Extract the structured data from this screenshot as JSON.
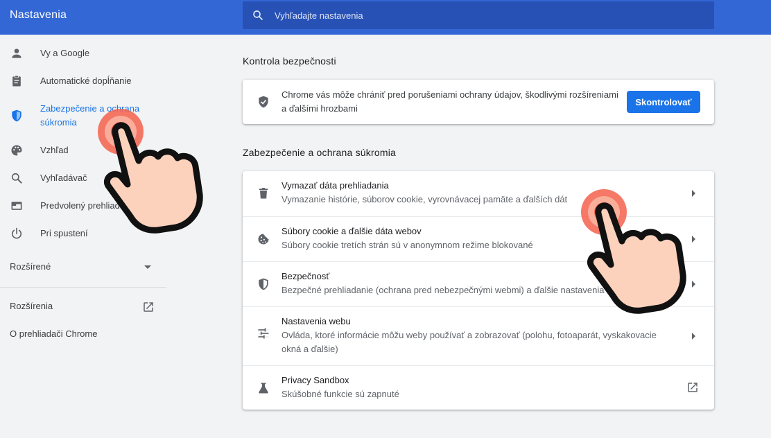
{
  "header": {
    "title": "Nastavenia",
    "search_placeholder": "Vyhľadajte nastavenia"
  },
  "sidebar": {
    "items": [
      {
        "label": "Vy a Google",
        "icon": "person-icon"
      },
      {
        "label": "Automatické dopĺňanie",
        "icon": "clipboard-icon"
      },
      {
        "label_line1": "Zabezpečenie a ochrana",
        "label_line2": "súkromia",
        "icon": "shield-icon"
      },
      {
        "label": "Vzhľad",
        "icon": "palette-icon"
      },
      {
        "label": "Vyhľadávač",
        "icon": "search-icon"
      },
      {
        "label": "Predvolený prehliadač",
        "icon": "browser-icon"
      },
      {
        "label": "Pri spustení",
        "icon": "power-icon"
      }
    ],
    "advanced_label": "Rozšírené",
    "extensions_label": "Rozšírenia",
    "about_label": "O prehliadači Chrome"
  },
  "main": {
    "safety_check": {
      "title": "Kontrola bezpečnosti",
      "text_line1": "Chrome vás môže chrániť pred porušeniami ochrany údajov, škodlivými rozšíreniami",
      "text_line2": "a ďalšími hrozbami",
      "button_label": "Skontrolovať"
    },
    "privacy": {
      "title": "Zabezpečenie a ochrana súkromia",
      "rows": [
        {
          "title": "Vymazať dáta prehliadania",
          "sub": "Vymazanie histórie, súborov cookie, vyrovnávacej pamäte a ďalších dát",
          "icon": "trash-icon"
        },
        {
          "title": "Súbory cookie a ďalšie dáta webov",
          "sub": "Súbory cookie tretích strán sú v anonymnom režime blokované",
          "icon": "cookie-icon"
        },
        {
          "title": "Bezpečnosť",
          "sub": "Bezpečné prehliadanie (ochrana pred nebezpečnými webmi) a ďalšie nastavenia zabezpečenia",
          "icon": "security-shield-icon"
        },
        {
          "title": "Nastavenia webu",
          "sub_line1": "Ovláda, ktoré informácie môžu weby používať a zobrazovať (polohu, fotoaparát, vyskakovacie",
          "sub_line2": "okná a ďalšie)",
          "icon": "tune-icon"
        },
        {
          "title": "Privacy Sandbox",
          "sub": "Skúšobné funkcie sú zapnuté",
          "icon": "flask-icon"
        }
      ]
    }
  },
  "colors": {
    "header": "#3367d6",
    "accent": "#1a73e8",
    "background": "#f1f3f4",
    "tap_ring": "#f4604c",
    "hand_fill": "#fcd2bd"
  }
}
